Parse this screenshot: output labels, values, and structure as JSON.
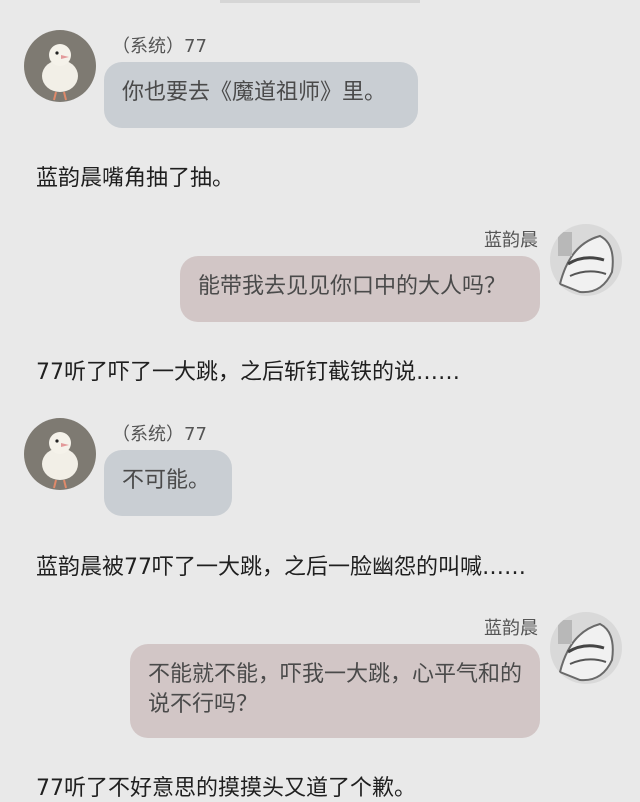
{
  "messages": [
    {
      "sender": "（系统）77",
      "text": "你也要去《魔道祖师》里。"
    },
    {
      "sender": "蓝韵晨",
      "text": "能带我去见见你口中的大人吗？"
    },
    {
      "sender": "（系统）77",
      "text": "不可能。"
    },
    {
      "sender": "蓝韵晨",
      "text": "不能就不能，吓我一大跳，心平气和的说不行吗？"
    }
  ],
  "narration": [
    "蓝韵晨嘴角抽了抽。",
    "77听了吓了一大跳，之后斩钉截铁的说……",
    "蓝韵晨被77吓了一大跳，之后一脸幽怨的叫喊……",
    "77听了不好意思的摸摸头又道了个歉。"
  ],
  "colors": {
    "background": "#e9e9e9",
    "left_bubble": "#c9ced3",
    "right_bubble": "#d2c6c6"
  },
  "icons": {
    "system_avatar": "bird-avatar-icon",
    "user_avatar": "anime-character-avatar-icon"
  }
}
